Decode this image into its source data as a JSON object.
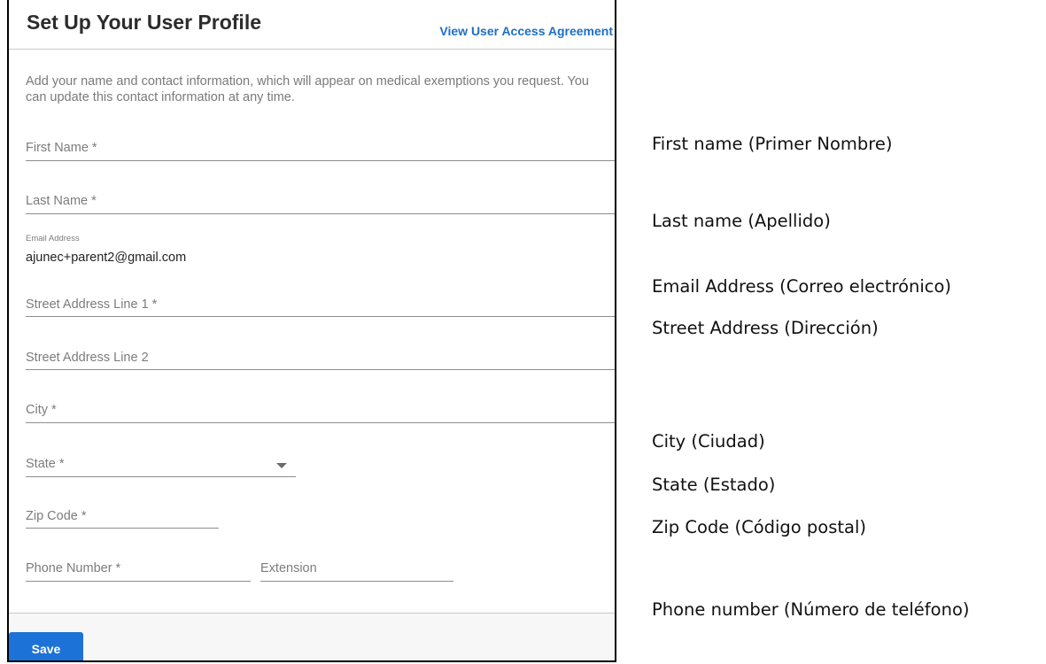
{
  "header": {
    "title": "Set Up Your User Profile",
    "agreement_link": "View User Access Agreement"
  },
  "intro": "Add your name and contact information, which will appear on medical exemptions you request. You can update this contact information at any time.",
  "form": {
    "first_name": {
      "label": "First Name *",
      "value": ""
    },
    "last_name": {
      "label": "Last Name *",
      "value": ""
    },
    "email": {
      "label": "Email Address",
      "value": "ajunec+parent2@gmail.com"
    },
    "street1": {
      "label": "Street Address Line 1 *",
      "value": ""
    },
    "street2": {
      "label": "Street Address Line 2",
      "value": ""
    },
    "city": {
      "label": "City *",
      "value": ""
    },
    "state": {
      "label": "State *",
      "value": ""
    },
    "zip": {
      "label": "Zip Code *",
      "value": ""
    },
    "phone": {
      "label": "Phone Number *",
      "value": ""
    },
    "extension": {
      "label": "Extension",
      "value": ""
    }
  },
  "footer": {
    "save_label": "Save"
  },
  "colors": {
    "accent": "#1d72d8",
    "link": "#1f6fc5"
  },
  "icons": {
    "state_dropdown": "caret-down-icon"
  },
  "notes": {
    "first_name": "First name (Primer Nombre)",
    "last_name": "Last name (Apellido)",
    "email": "Email Address (Correo electrónico)",
    "street": "Street Address (Dirección)",
    "city": "City (Ciudad)",
    "state": "State (Estado)",
    "zip": "Zip Code (Código postal)",
    "phone": "Phone number (Número de teléfono)"
  }
}
